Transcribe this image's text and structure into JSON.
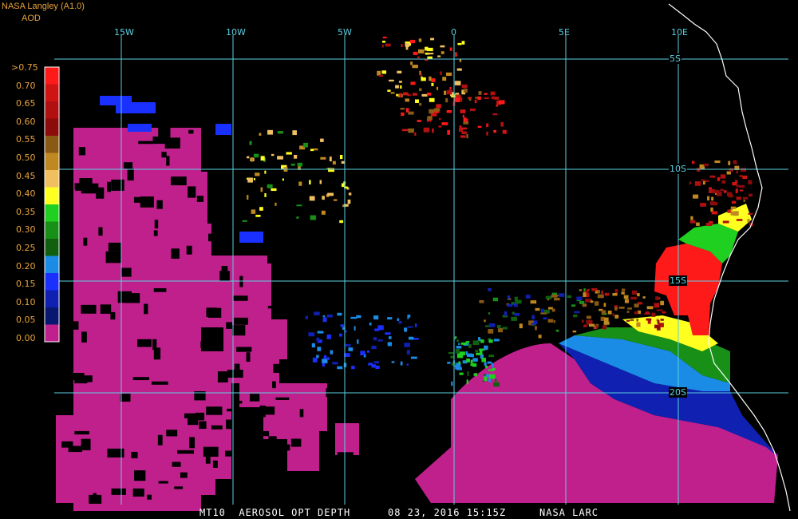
{
  "header": {
    "credit": "NASA Langley (A1.0)",
    "product": "AOD"
  },
  "colorbar": {
    "labels": [
      ">0.75",
      "0.70",
      "0.65",
      "0.60",
      "0.55",
      "0.50",
      "0.45",
      "0.40",
      "0.35",
      "0.30",
      "0.25",
      "0.20",
      "0.15",
      "0.10",
      "0.05",
      "0.00"
    ],
    "colors": [
      "#ff1a1a",
      "#d01414",
      "#b01010",
      "#8c0c0c",
      "#8a5a14",
      "#c08820",
      "#f0c060",
      "#ffff20",
      "#20d020",
      "#189018",
      "#106010",
      "#1a8ce6",
      "#1a30ff",
      "#1020b0",
      "#081870",
      "#c0208c"
    ]
  },
  "grid": {
    "longitude_labels": [
      "15W",
      "10W",
      "5W",
      "0",
      "5E",
      "10E"
    ],
    "latitude_labels": [
      "5S",
      "10S",
      "15S",
      "20S"
    ]
  },
  "footer": {
    "product": "MT10  AEROSOL OPT DEPTH",
    "date": "08 23, 2016 15:15Z",
    "agency": "NASA LARC"
  }
}
